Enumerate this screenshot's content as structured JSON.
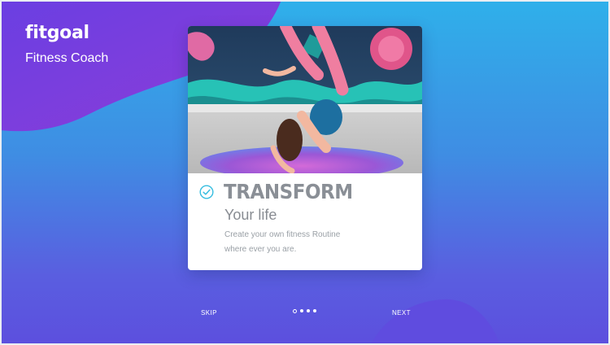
{
  "brand": {
    "name": "fitgoal",
    "tagline": "Fitness Coach"
  },
  "card": {
    "image_alt": "woman doing yoga backbend on a mat in front of a graffiti wall",
    "title": "TRANSFORM",
    "subtitle": "Your life",
    "description_line1": "Create your own fitness Routine",
    "description_line2": "where ever you are."
  },
  "footer": {
    "skip_label": "SKIP",
    "next_label": "NEXT",
    "pagination": {
      "total": 4,
      "current": 1
    }
  },
  "colors": {
    "background_top": "#2fb0ea",
    "background_bottom": "#5c4fde",
    "blob": "#7c3fe0",
    "check_accent": "#36bde0",
    "title_text": "#8a8f96"
  },
  "icons": {
    "check": "check-circle-icon"
  }
}
